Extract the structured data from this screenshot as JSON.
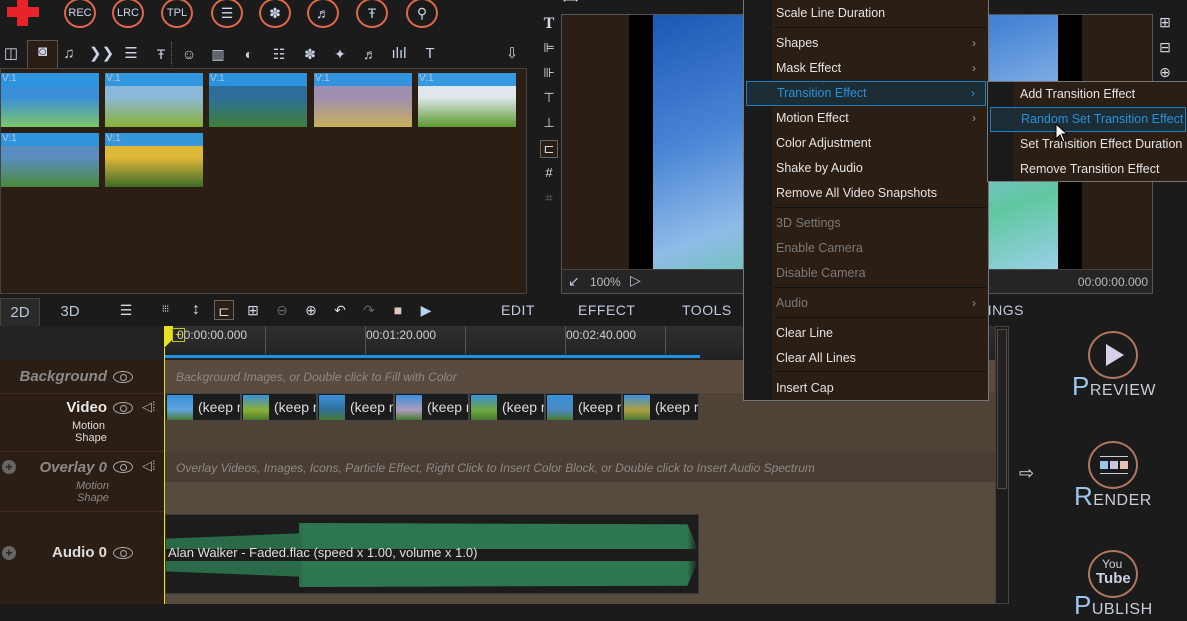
{
  "top_toolbar": {
    "add_label": "+",
    "buttons": [
      {
        "label": "REC",
        "icon": "record-icon"
      },
      {
        "label": "LRC",
        "icon": "lyrics-icon"
      },
      {
        "label": "TPL",
        "icon": "template-icon"
      },
      {
        "label": "",
        "icon": "list-icon"
      },
      {
        "label": "",
        "icon": "flower-icon"
      },
      {
        "label": "",
        "icon": "music-score-icon"
      },
      {
        "label": "",
        "icon": "text-style-icon"
      },
      {
        "label": "",
        "icon": "user-icon"
      }
    ]
  },
  "media_toolbar": {
    "icons": [
      "layout-icon",
      "camera-icon",
      "music-note-icon",
      "transition-icon",
      "playlist-icon",
      "text-style-icon",
      "smiley-icon",
      "battery-icon",
      "contrast-icon",
      "list-icon",
      "flower-icon",
      "puzzle-icon",
      "music-score-icon",
      "equalizer-icon",
      "text-icon",
      "download-icon"
    ],
    "glyphs": [
      "◫",
      "◙",
      "♫",
      "❯❯",
      "☰",
      "Ŧ",
      "☺",
      "▥",
      "◐",
      "☷",
      "✽",
      "✦",
      "♬",
      "ılıl",
      "T",
      "⇩"
    ]
  },
  "media_items": [
    {
      "label": "V:1",
      "colors": [
        "#3a8fd8",
        "#7dc66a"
      ]
    },
    {
      "label": "V:1",
      "colors": [
        "#8bb8d8",
        "#8bb035"
      ]
    },
    {
      "label": "V:1",
      "colors": [
        "#2d6f9a",
        "#3f7f38"
      ]
    },
    {
      "label": "V:1",
      "colors": [
        "#9f8fb0",
        "#c8b05a"
      ]
    },
    {
      "label": "V:1",
      "colors": [
        "#dfe6ec",
        "#5d9a2e"
      ]
    },
    {
      "label": "V:1",
      "colors": [
        "#5a8ec0",
        "#4a8a3a"
      ]
    },
    {
      "label": "V:1",
      "colors": [
        "#e0b838",
        "#3e6a28"
      ]
    }
  ],
  "preview": {
    "zoom": "100%",
    "timecode": "00:00:00.000",
    "side_icons": [
      "text-icon",
      "align-left-icon",
      "align-right-icon",
      "align-top-icon",
      "align-bottom-icon",
      "fit-frame-icon",
      "grid-icon",
      "grid-off-icon"
    ],
    "side_glyphs": [
      "T",
      "⊫",
      "⊪",
      "⊤",
      "⊥",
      "⊏",
      "#",
      "⌗"
    ],
    "right_icons": [
      "center-horizontal-icon",
      "center-vertical-icon",
      "center-icon"
    ],
    "right_glyphs": [
      "⊞",
      "⊟",
      "⊕"
    ]
  },
  "context_menu": {
    "items": [
      {
        "label": "Scale Line Duration",
        "disabled": false,
        "submenu": false
      },
      {
        "label": "Shapes",
        "disabled": false,
        "submenu": true
      },
      {
        "label": "Mask Effect",
        "disabled": false,
        "submenu": true
      },
      {
        "label": "Transition Effect",
        "disabled": false,
        "submenu": true,
        "highlighted": true
      },
      {
        "label": "Motion Effect",
        "disabled": false,
        "submenu": true
      },
      {
        "label": "Color Adjustment",
        "disabled": false,
        "submenu": false
      },
      {
        "label": "Shake by Audio",
        "disabled": false,
        "submenu": false
      },
      {
        "label": "Remove All Video Snapshots",
        "disabled": false,
        "submenu": false
      },
      {
        "label": "3D Settings",
        "disabled": true,
        "submenu": false
      },
      {
        "label": "Enable Camera",
        "disabled": true,
        "submenu": false
      },
      {
        "label": "Disable Camera",
        "disabled": true,
        "submenu": false
      },
      {
        "label": "Audio",
        "disabled": true,
        "submenu": true
      },
      {
        "label": "Clear Line",
        "disabled": false,
        "submenu": false
      },
      {
        "label": "Clear All Lines",
        "disabled": false,
        "submenu": false
      },
      {
        "label": "Insert Cap",
        "disabled": false,
        "submenu": false
      }
    ],
    "arrow": "›"
  },
  "submenu": {
    "items": [
      {
        "label": "Add Transition Effect"
      },
      {
        "label": "Random Set Transition Effect",
        "highlighted": true
      },
      {
        "label": "Set Transition Effect Duration"
      },
      {
        "label": "Remove Transition Effect"
      }
    ]
  },
  "mode_tabs": [
    {
      "label": "2D",
      "active": true
    },
    {
      "label": "3D",
      "active": false
    }
  ],
  "timeline_toolbar": {
    "icons": [
      "align-lines-icon",
      "dotted-grid-icon",
      "vertical-resize-icon",
      "fit-frame-icon",
      "split-icon",
      "zoom-out-icon",
      "zoom-in-icon",
      "undo-icon",
      "redo-icon",
      "stop-icon",
      "play-icon"
    ],
    "glyphs": [
      "☰",
      "⁝⁝⁝",
      "↕",
      "⊏",
      "⊞",
      "⊖",
      "⊕",
      "↶",
      "↷",
      "■",
      "▶"
    ]
  },
  "main_tabs": [
    "EDIT",
    "EFFECT",
    "TOOLS",
    "SETTINGS"
  ],
  "ruler": {
    "labels": [
      "00:00:00.000",
      "00:01:20.000",
      "00:02:40.000"
    ]
  },
  "tracks": {
    "background": {
      "name": "Background",
      "hint": "Background Images, or Double click to Fill with Color"
    },
    "video": {
      "name": "Video",
      "sub1": "Motion",
      "sub2": "Shape",
      "clips": [
        {
          "label": "(keep r",
          "color": "#5fa3de"
        },
        {
          "label": "(keep r",
          "color": "#8bb035"
        },
        {
          "label": "(keep r",
          "color": "#2d6f9a"
        },
        {
          "label": "(keep r",
          "color": "#b09cc0"
        },
        {
          "label": "(keep r",
          "color": "#6fa640"
        },
        {
          "label": "(keep r",
          "color": "#4a8ac0"
        },
        {
          "label": "(keep r",
          "color": "#b0a040"
        }
      ]
    },
    "overlay": {
      "name": "Overlay 0",
      "sub1": "Motion",
      "sub2": "Shape",
      "hint": "Overlay Videos, Images, Icons, Particle Effect, Right Click to Insert Color Block, or Double click to Insert Audio Spectrum"
    },
    "audio": {
      "name": "Audio 0",
      "clip": "Alan Walker - Faded.flac  (speed x 1.00, volume x 1.0)"
    }
  },
  "right_panel": {
    "preview": {
      "first": "P",
      "rest": "REVIEW"
    },
    "render": {
      "first": "R",
      "rest": "ENDER"
    },
    "publish": {
      "first": "P",
      "rest": "UBLISH",
      "you": "You",
      "tube": "Tube"
    },
    "arrow": "⇨"
  },
  "colors": {
    "accent": "#1d7fc0",
    "playhead": "#e8e020",
    "audio_wave": "#2a6a48",
    "brand_red": "#e8232a"
  }
}
